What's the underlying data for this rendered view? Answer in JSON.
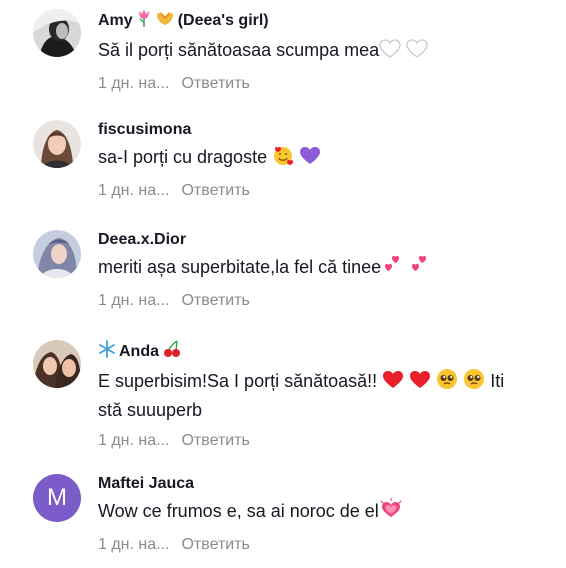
{
  "comments": [
    {
      "username_pre": "Amy",
      "username_post": "(Deea's girl)",
      "icon_after_name": [
        "tulip-icon",
        "heart-hands-icon"
      ],
      "text": "Să il porți sănătoasaa scumpa mea",
      "time": "1 дн. на...",
      "reply": "Ответить"
    },
    {
      "username": "fiscusimona",
      "text": "sa-I porți cu dragoste",
      "time": "1 дн. на...",
      "reply": "Ответить"
    },
    {
      "username": "Deea.x.Dior",
      "text": "meriti așa superbitate,la fel că tinee",
      "time": "1 дн. на...",
      "reply": "Ответить"
    },
    {
      "username": "Anda",
      "text_a": "E superbisim!Sa I porți sănătoasă!!",
      "text_b": "Iti",
      "text_line2": "stă suuuperb",
      "time": "1 дн. на...",
      "reply": "Ответить"
    },
    {
      "username": "Maftei Jauca",
      "avatar_letter": "M",
      "text": "Wow ce frumos e, sa ai noroc de el",
      "time": "1 дн. на...",
      "reply": "Ответить"
    }
  ],
  "colors": {
    "username": "#161823",
    "meta": "#8a8b91",
    "avatar_letter_bg": "#7b5cc9",
    "heart_red": "#e8202c",
    "heart_purple": "#8e5bd6",
    "sparkle_pink": "#f0437e"
  }
}
